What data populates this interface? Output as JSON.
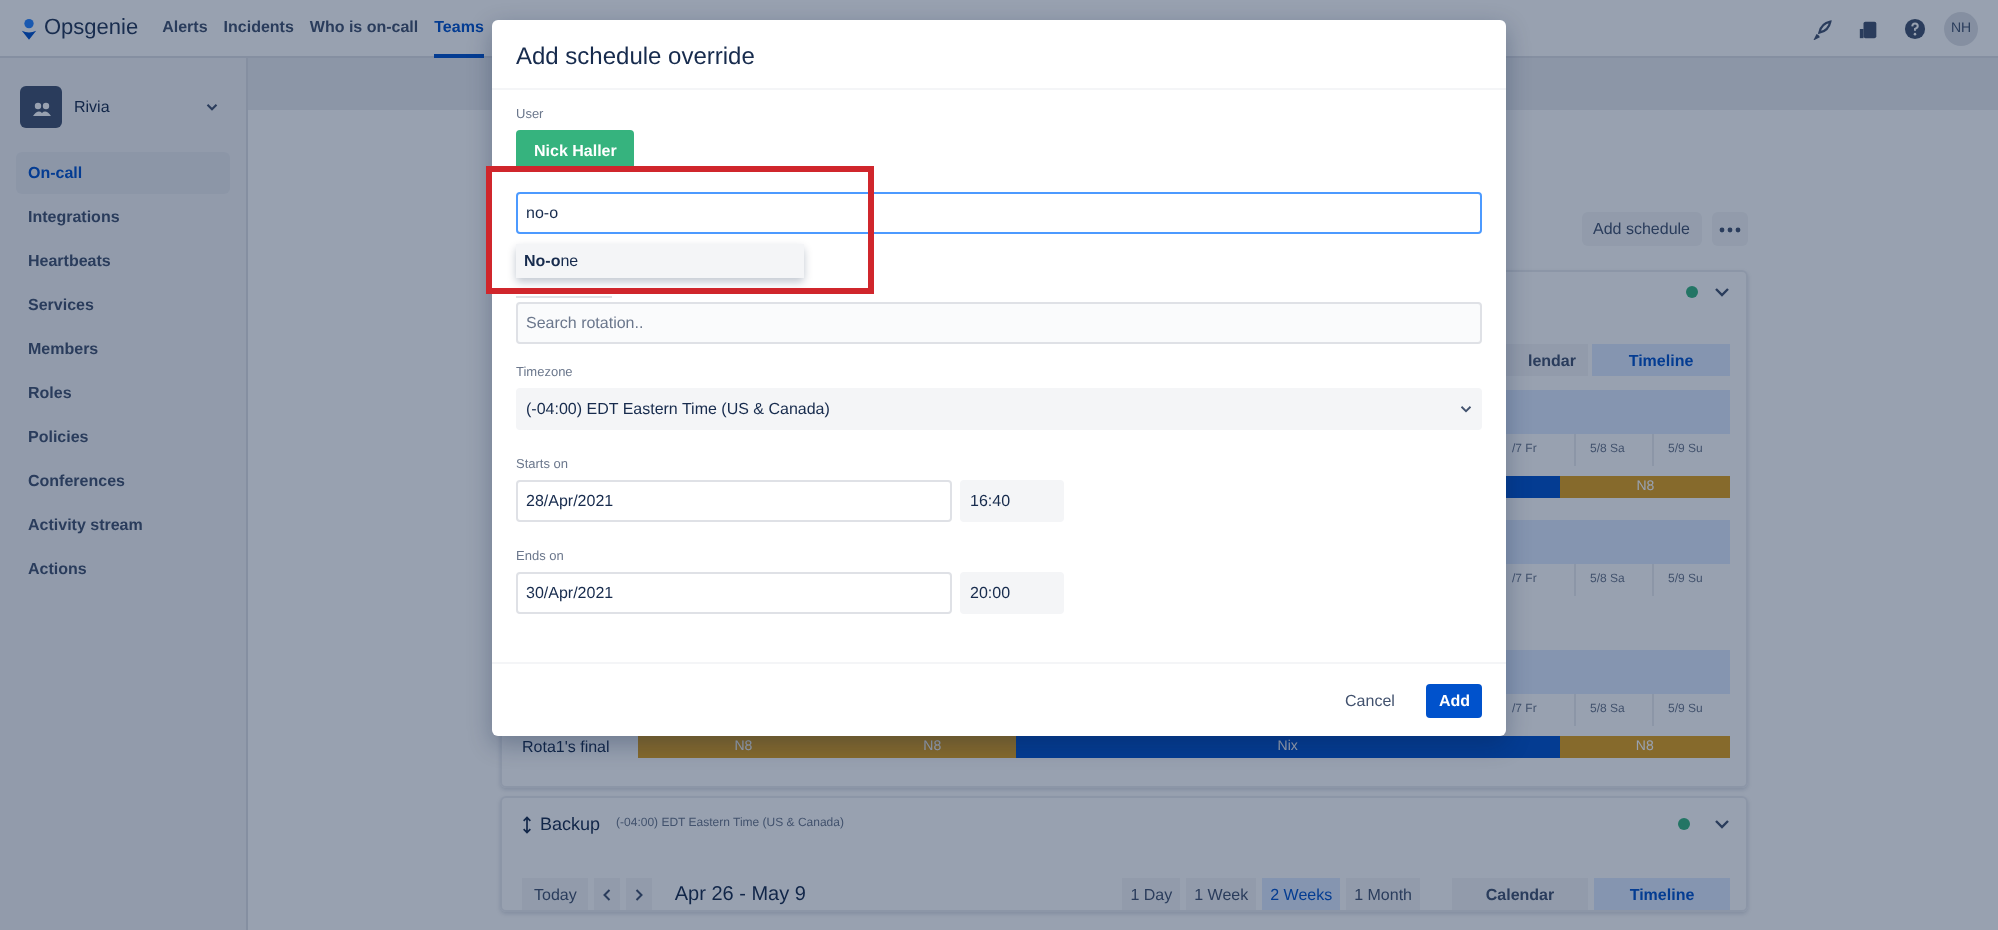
{
  "nav": {
    "logo": "Opsgenie",
    "links": [
      {
        "label": "Alerts",
        "selected": false
      },
      {
        "label": "Incidents",
        "selected": false
      },
      {
        "label": "Who is on-call",
        "selected": false
      },
      {
        "label": "Teams",
        "selected": true
      }
    ],
    "avatar": "NH"
  },
  "sidebar": {
    "team": "Rivia",
    "items": [
      {
        "label": "On-call",
        "selected": true
      },
      {
        "label": "Integrations",
        "selected": false
      },
      {
        "label": "Heartbeats",
        "selected": false
      },
      {
        "label": "Services",
        "selected": false
      },
      {
        "label": "Members",
        "selected": false
      },
      {
        "label": "Roles",
        "selected": false
      },
      {
        "label": "Policies",
        "selected": false
      },
      {
        "label": "Conferences",
        "selected": false
      },
      {
        "label": "Activity stream",
        "selected": false
      },
      {
        "label": "Actions",
        "selected": false
      }
    ]
  },
  "main": {
    "add_button": "Add schedule",
    "schedule": {
      "view_tabs": [
        {
          "label": "lendar",
          "selected": false
        },
        {
          "label": "Timeline",
          "selected": true
        }
      ],
      "groups": [
        {
          "dates": [
            "/7 Fr",
            "5/8 Sa",
            "5/9 Su"
          ],
          "bars": [
            {
              "kind": "nix"
            },
            {
              "label": "N8",
              "kind": "n8"
            }
          ]
        },
        {
          "dates": [
            "/7 Fr",
            "5/8 Sa",
            "5/9 Su"
          ]
        },
        {
          "dates": [
            "/7 Fr",
            "5/8 Sa",
            "5/9 Su"
          ],
          "name": "Rota1's final",
          "bars": [
            {
              "label": "N8",
              "kind": "n8"
            },
            {
              "label": "N8",
              "kind": "n8"
            },
            {
              "label": "Nix",
              "kind": "nix"
            },
            {
              "label": "N8",
              "kind": "n8"
            }
          ]
        }
      ]
    },
    "backup": {
      "title": "Backup",
      "timezone": "(-04:00) EDT Eastern Time (US & Canada)",
      "today": "Today",
      "range": "Apr 26 - May 9",
      "periods": [
        {
          "label": "1 Day",
          "selected": false
        },
        {
          "label": "1 Week",
          "selected": false
        },
        {
          "label": "2 Weeks",
          "selected": true
        },
        {
          "label": "1 Month",
          "selected": false
        }
      ],
      "views": [
        {
          "label": "Calendar",
          "selected": false
        },
        {
          "label": "Timeline",
          "selected": true
        }
      ]
    }
  },
  "modal": {
    "title": "Add schedule override",
    "user_label": "User",
    "user_chip": "Nick Haller",
    "search": {
      "value": "no-o"
    },
    "suggestions": [
      {
        "label": "**No-o**ne",
        "selected": true
      }
    ],
    "rotation_search": {
      "placeholder": "Search rotation.."
    },
    "timezone": {
      "label": "Timezone",
      "value": "(-04:00) EDT Eastern Time (US & Canada)"
    },
    "starts": {
      "label": "Starts on",
      "date": "28/Apr/2021",
      "time": "16:40"
    },
    "ends": {
      "label": "Ends on",
      "date": "30/Apr/2021",
      "time": "20:00"
    },
    "buttons": [
      {
        "label": "Cancel",
        "kind": "subtle"
      },
      {
        "label": "Add",
        "kind": "primary"
      }
    ]
  }
}
